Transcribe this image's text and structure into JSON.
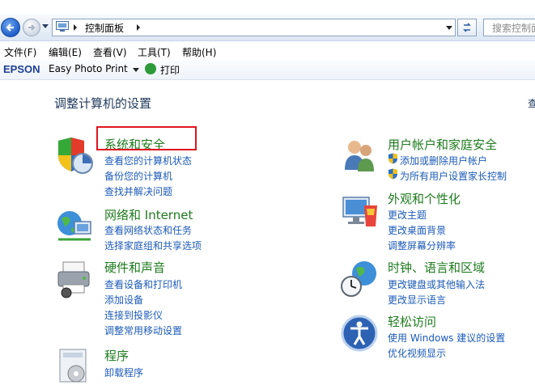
{
  "address": {
    "breadcrumb": "控制面板",
    "search_placeholder": "搜索控制面"
  },
  "menu": [
    "文件(F)",
    "编辑(E)",
    "查看(V)",
    "工具(T)",
    "帮助(H)"
  ],
  "toolbar": {
    "brand": "EPSON",
    "app": "Easy Photo Print",
    "print": "打印"
  },
  "page": {
    "heading": "调整计算机的设置",
    "right_cut_text": "查"
  },
  "categories_left": [
    {
      "title": "系统和安全",
      "links": [
        "查看您的计算机状态",
        "备份您的计算机",
        "查找并解决问题"
      ]
    },
    {
      "title": "网络和 Internet",
      "links": [
        "查看网络状态和任务",
        "选择家庭组和共享选项"
      ]
    },
    {
      "title": "硬件和声音",
      "links": [
        "查看设备和打印机",
        "添加设备",
        "连接到投影仪",
        "调整常用移动设置"
      ]
    },
    {
      "title": "程序",
      "links": [
        "卸载程序"
      ]
    }
  ],
  "categories_right": [
    {
      "title": "用户帐户和家庭安全",
      "links": [
        "添加或删除用户帐户",
        "为所有用户设置家长控制"
      ]
    },
    {
      "title": "外观和个性化",
      "links": [
        "更改主题",
        "更改桌面背景",
        "调整屏幕分辨率"
      ]
    },
    {
      "title": "时钟、语言和区域",
      "links": [
        "更改键盘或其他输入法",
        "更改显示语言"
      ]
    },
    {
      "title": "轻松访问",
      "links": [
        "使用 Windows 建议的设置",
        "优化视频显示"
      ]
    }
  ],
  "colors": {
    "accent_green": "#1e7b1e",
    "link_blue": "#1c5bb8",
    "highlight_red": "#e0141e"
  }
}
